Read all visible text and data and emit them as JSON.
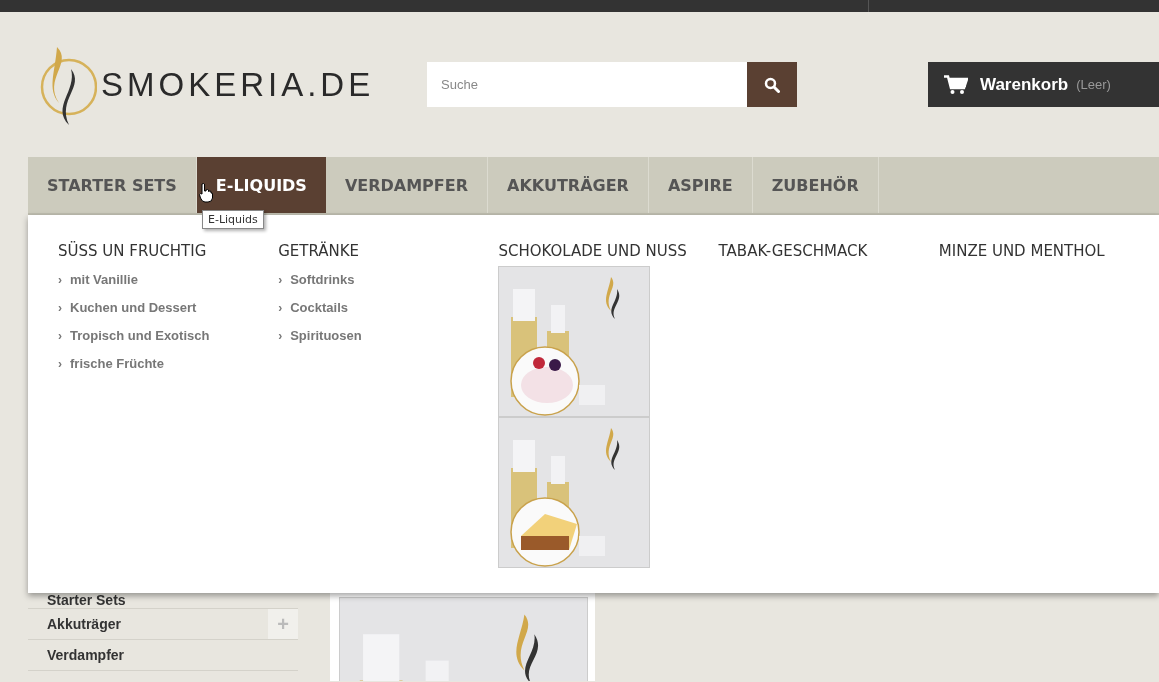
{
  "header": {
    "logo_text": "SMOKERIA.DE",
    "search": {
      "placeholder": "Suche"
    },
    "cart": {
      "label": "Warenkorb",
      "status": "(Leer)"
    }
  },
  "nav": {
    "tabs": [
      {
        "label": "STARTER SETS",
        "selected": false
      },
      {
        "label": "E-LIQUIDS",
        "selected": true
      },
      {
        "label": "VERDAMPFER",
        "selected": false
      },
      {
        "label": "AKKUTRÄGER",
        "selected": false
      },
      {
        "label": "ASPIRE",
        "selected": false
      },
      {
        "label": "ZUBEHÖR",
        "selected": false
      }
    ],
    "tooltip": "E-Liquids"
  },
  "dropdown": {
    "columns": [
      {
        "heading": "SÜSS UN FRUCHTIG",
        "links": [
          {
            "marker": "›",
            "label": "mit Vanillie"
          },
          {
            "marker": "›",
            "label": "Kuchen und Dessert"
          },
          {
            "marker": "›",
            "label": "Tropisch und Exotisch"
          },
          {
            "marker": "›",
            "label": "frische Früchte"
          }
        ]
      },
      {
        "heading": "GETRÄNKE",
        "links": [
          {
            "marker": "›",
            "label": "Softdrinks"
          },
          {
            "marker": "›",
            "label": "Cocktails"
          },
          {
            "marker": "›",
            "label": "Spirituosen"
          }
        ]
      },
      {
        "heading": "SCHOKOLADE UND NUSS"
      },
      {
        "heading": "TABAK-GESCHMACK"
      },
      {
        "heading": "MINZE UND MENTHOL"
      }
    ]
  },
  "sidebar": {
    "items": [
      {
        "label": "Starter Sets",
        "expandable": false
      },
      {
        "label": "Akkuträger",
        "expandable": true,
        "toggle": "+"
      },
      {
        "label": "Verdampfer",
        "expandable": false
      }
    ]
  }
}
